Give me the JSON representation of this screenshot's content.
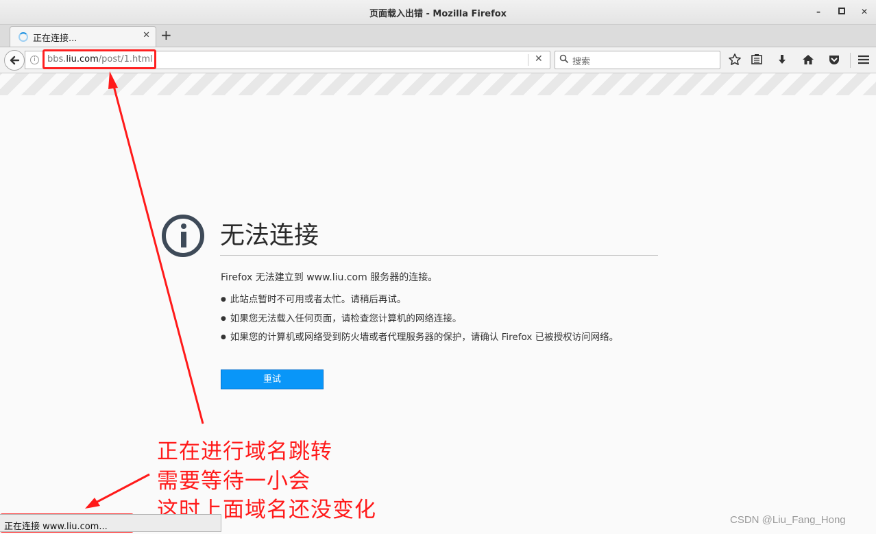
{
  "window": {
    "title": "页面载入出错 - Mozilla Firefox",
    "minimize_glyph": "–",
    "maximize_glyph": "▫",
    "close_glyph": "✕"
  },
  "tab": {
    "title": "正在连接...",
    "close_glyph": "✕",
    "new_tab_glyph": "+"
  },
  "navbar": {
    "back_glyph": "←",
    "url_host": "bbs.liu.com",
    "url_prefix": "bbs.",
    "url_domain": "liu.com",
    "url_path": "/post/1.html",
    "clear_glyph": "✕",
    "search_placeholder": "搜索",
    "icons": [
      "star-icon",
      "reading-list-icon",
      "download-icon",
      "home-icon",
      "pocket-icon",
      "menu-icon"
    ]
  },
  "error": {
    "title": "无法连接",
    "description": "Firefox 无法建立到 www.liu.com 服务器的连接。",
    "bullets": [
      "此站点暂时不可用或者太忙。请稍后再试。",
      "如果您无法载入任何页面，请检查您计算机的网络连接。",
      "如果您的计算机或网络受到防火墙或者代理服务器的保护，请确认 Firefox 已被授权访问网络。"
    ],
    "retry_label": "重试"
  },
  "annotation": {
    "color": "#ff1a1a",
    "lines": [
      "正在进行域名跳转",
      "需要等待一小会",
      "这时上面域名还没变化"
    ]
  },
  "status": {
    "text": "正在连接 www.liu.com..."
  },
  "watermark": "CSDN @Liu_Fang_Hong",
  "colors": {
    "retry_button": "#0996f8",
    "error_icon": "#3e4a58",
    "annotation_red": "#ff1a1a"
  }
}
